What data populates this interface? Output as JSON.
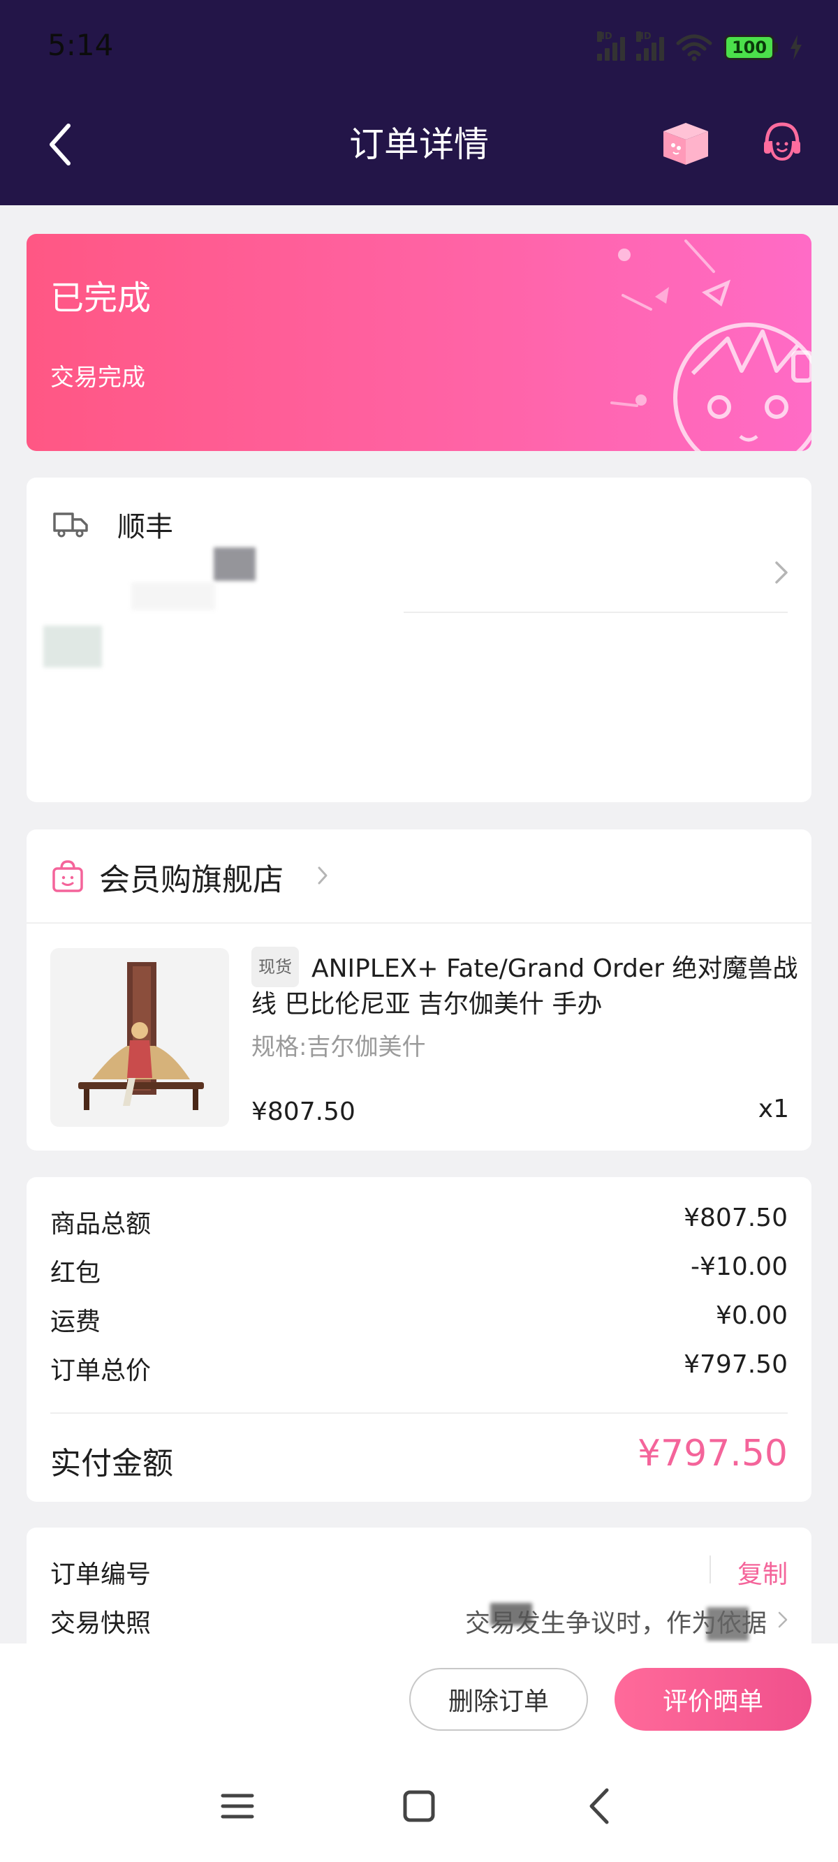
{
  "status_bar": {
    "time": "5:14",
    "signal_label": "HD",
    "battery": "100"
  },
  "header": {
    "title": "订单详情"
  },
  "order_status": {
    "title": "已完成",
    "subtitle": "交易完成"
  },
  "shipping": {
    "carrier": "顺丰"
  },
  "store": {
    "name": "会员购旗舰店"
  },
  "product": {
    "tag": "现货",
    "title": "ANIPLEX+ Fate/Grand Order 绝对魔兽战线 巴比伦尼亚 吉尔伽美什 手办",
    "spec": "规格:吉尔伽美什",
    "price": "¥807.50",
    "quantity": "x1"
  },
  "summary": {
    "rows": [
      {
        "label": "商品总额",
        "value": "¥807.50"
      },
      {
        "label": "红包",
        "value": "-¥10.00"
      },
      {
        "label": "运费",
        "value": "¥0.00"
      },
      {
        "label": "订单总价",
        "value": "¥797.50"
      }
    ],
    "paid_label": "实付金额",
    "paid_value": "¥797.50"
  },
  "order_info": {
    "order_no_label": "订单编号",
    "copy_label": "复制",
    "snapshot_label": "交易快照",
    "snapshot_text": "交易发生争议时，作为依据"
  },
  "actions": {
    "delete_label": "删除订单",
    "review_label": "评价晒单"
  },
  "colors": {
    "header_bg": "#231548",
    "accent": "#F4649A",
    "banner_start": "#FF5784",
    "banner_end": "#FF6BC6"
  }
}
